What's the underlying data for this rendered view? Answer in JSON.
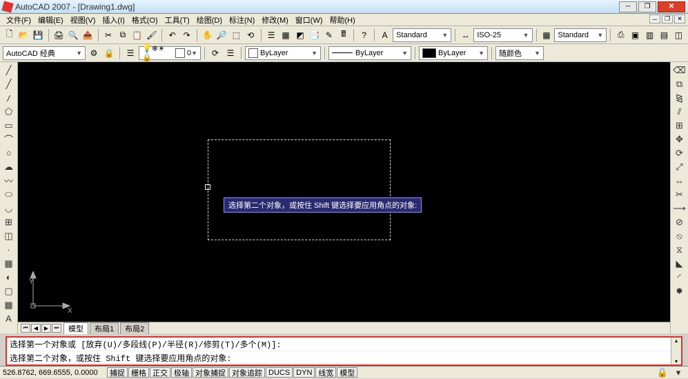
{
  "titlebar": {
    "title": "AutoCAD 2007 - [Drawing1.dwg]"
  },
  "menu": {
    "file": "文件(F)",
    "edit": "编辑(E)",
    "view": "视图(V)",
    "insert": "插入(I)",
    "format": "格式(O)",
    "tools": "工具(T)",
    "draw": "绘图(D)",
    "dimension": "标注(N)",
    "modify": "修改(M)",
    "window": "窗口(W)",
    "help": "帮助(H)"
  },
  "toolbar1": {
    "std_style": "Standard",
    "dim_style": "ISO-25",
    "tbl_style": "Standard"
  },
  "toolbar2": {
    "workspace": "AutoCAD 经典",
    "layer": "0",
    "color_label": "ByLayer",
    "linetype_label": "ByLayer",
    "lineweight_label": "ByLayer",
    "plot_label": "随颜色"
  },
  "canvas": {
    "tooltip": "选择第二个对象，或按住 Shift 键选择要应用角点的对象:",
    "ucs": {
      "x": "X",
      "y": "Y"
    }
  },
  "layout_tabs": {
    "model": "模型",
    "layout1": "布局1",
    "layout2": "布局2"
  },
  "command": {
    "line1": "选择第一个对象或 [放弃(U)/多段线(P)/半径(R)/修剪(T)/多个(M)]:",
    "line2": "选择第二个对象，或按住 Shift 键选择要应用角点的对象:"
  },
  "status": {
    "coords": "526.8762, 669.6555, 0.0000",
    "snap": "捕捉",
    "grid": "栅格",
    "ortho": "正交",
    "polar": "极轴",
    "osnap": "对象捕捉",
    "otrack": "对象追踪",
    "ducs": "DUCS",
    "dyn": "DYN",
    "lwt": "线宽",
    "model": "模型"
  }
}
